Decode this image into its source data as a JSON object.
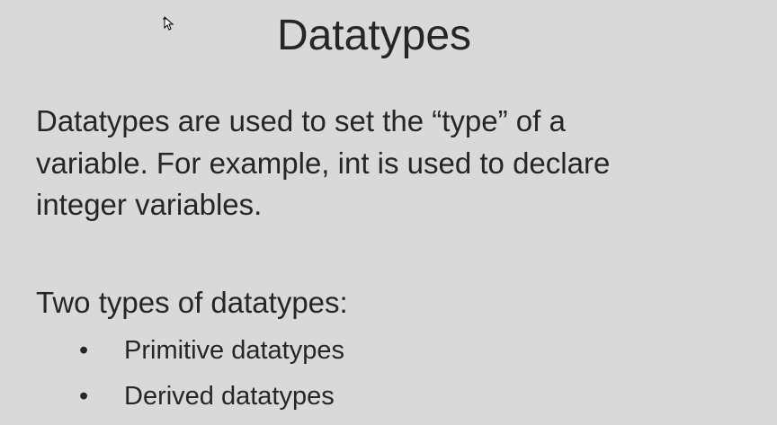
{
  "slide": {
    "title": "Datatypes",
    "body_lines": [
      "Datatypes are used to set the “type” of a",
      "variable. For example, int is used to declare",
      "integer variables."
    ],
    "subheading": "Two types of datatypes:",
    "bullets": [
      "Primitive datatypes",
      "Derived datatypes"
    ],
    "bullet_glyph": "•"
  },
  "colors": {
    "background": "#d9d9d9",
    "text": "#262626"
  },
  "cursor_icon": "move-arrow-cursor"
}
